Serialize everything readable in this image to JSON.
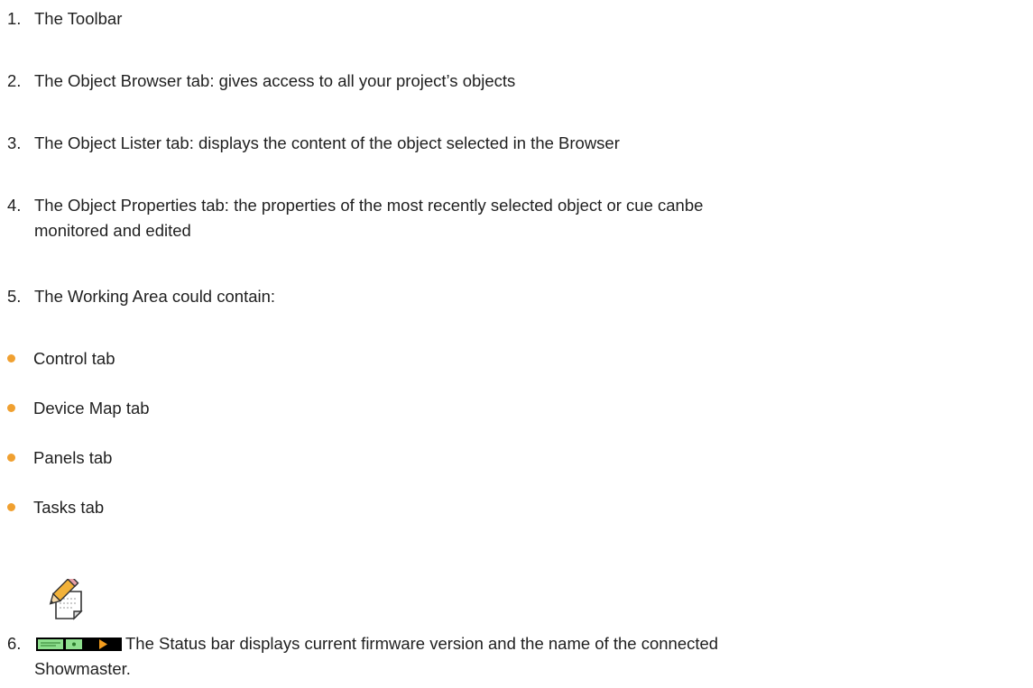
{
  "items": [
    {
      "number": "1.",
      "text": "The Toolbar"
    },
    {
      "number": "2.",
      "text": "The Object Browser tab: gives access to all your project’s objects"
    },
    {
      "number": "3.",
      "text": "The Object Lister tab: displays the content of the object selected in the Browser"
    },
    {
      "number": "4.",
      "text": "The Object Properties tab: the properties of the most recently selected object or cue canbe",
      "continuation": "monitored and edited"
    },
    {
      "number": "5.",
      "text": "The Working Area could contain:"
    }
  ],
  "bullets": [
    "Control tab",
    "Device Map tab",
    "Panels tab",
    "Tasks tab"
  ],
  "item6": {
    "number": "6.",
    "text": "The Status bar displays current firmware version and the name of the connected",
    "continuation": "Showmaster."
  },
  "icons": {
    "note": "note-pencil-icon",
    "status": "status-bar-icon"
  },
  "colors": {
    "bullet": "#f0a030",
    "text": "#1f1f1f"
  }
}
